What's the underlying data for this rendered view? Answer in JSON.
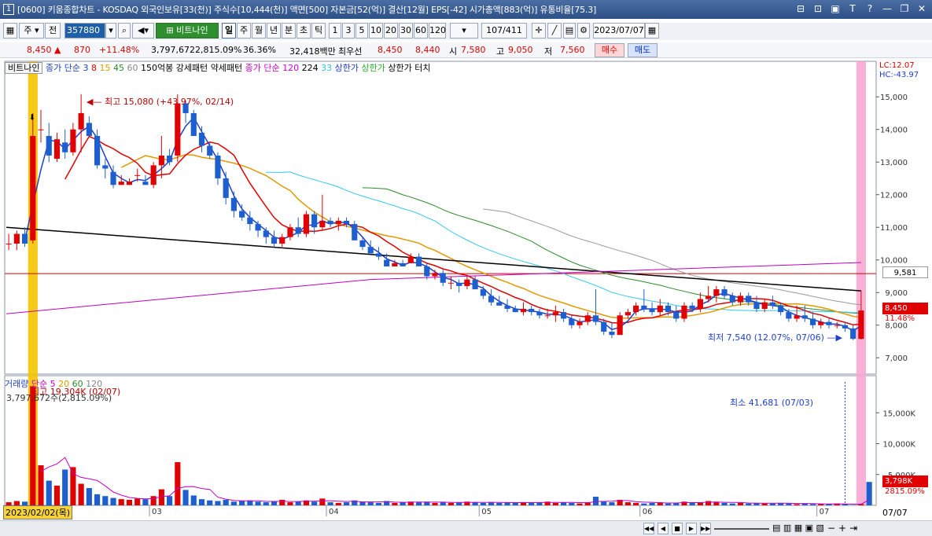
{
  "window": {
    "number": "1",
    "title": "[0600] 키움종합차트 - KOSDAQ 외국인보유[33(천)] 주식수[10,444(천)] 액면[500] 자본금[52(억)] 결산[12월] EPS[-42] 시가총액[883(억)] 유통비율[75.3]"
  },
  "toolbar": {
    "market": "주",
    "type": "전",
    "code": "357880",
    "stock_name": "비트나인",
    "periods": [
      "일",
      "주",
      "월",
      "년",
      "분",
      "초",
      "틱"
    ],
    "active_period": "일",
    "intervals": [
      "1",
      "3",
      "5",
      "10",
      "20",
      "30",
      "60",
      "120"
    ],
    "count": "107",
    "count_total": "/411",
    "date": "2023/07/07"
  },
  "quote": {
    "price": "8,450",
    "arrow": "▲",
    "change": "870",
    "change_pct": "+11.48%",
    "volume": "3,797,672",
    "turnover": "2,815.09%",
    "turnover2": "36.36%",
    "amount": "32,418백만",
    "bid_label": "최우선",
    "ask": "8,450",
    "bid": "8,440",
    "open_label": "시",
    "open": "7,580",
    "high_label": "고",
    "high": "9,050",
    "low_label": "저",
    "low": "7,560",
    "buy_label": "매수",
    "sell_label": "매도"
  },
  "legend_top": {
    "name": "비트나인",
    "ma_label": "종가 단순",
    "ma_periods": [
      "3",
      "8",
      "15",
      "45",
      "60"
    ],
    "box1": "150억봉 강세패턴",
    "box2": "약세패턴",
    "ma2_label": "종가 단순 120",
    "ma2_a": "224",
    "ma2_b": "33",
    "limit1": "상한가",
    "limit2": "상한가",
    "limit3": "상한가 터치"
  },
  "legend_vol": {
    "label": "거래량",
    "ma_label": "단순 5",
    "p20": "20",
    "p60": "60",
    "p120": "120",
    "max_text": "최고 19,304K (02/07)",
    "cur_text": "3,797,672주(2,815.09%)"
  },
  "annotations": {
    "high": "최고 15,080 (+43.97%, 02/14)",
    "low": "최저 7,540 (12.07%, 07/06)",
    "vol_min": "최소 41,681 (07/03)",
    "lc": "LC:12.07",
    "hc": "HC:-43.97",
    "hline_value": "9,581",
    "price_tag": "8,450",
    "pct_tag": "11.48%",
    "vol_tag": "3,798K",
    "vol_pct_tag": "2815.09%"
  },
  "x_axis": {
    "start_date": "2023/02/02(목)",
    "months": [
      "03",
      "04",
      "05",
      "06",
      "07"
    ],
    "end": "07/07"
  },
  "chart_data": [
    {
      "type": "candlestick",
      "y_ticks": [
        "15,000",
        "14,000",
        "13,000",
        "12,000",
        "11,000",
        "10,000",
        "9,000",
        "8,000",
        "7,000"
      ],
      "ylim": [
        6500,
        15800
      ],
      "ohlc": [
        [
          10500,
          10800,
          10300,
          10500
        ],
        [
          10500,
          10900,
          10300,
          10800
        ],
        [
          10800,
          11000,
          10400,
          10500
        ],
        [
          10600,
          14500,
          10500,
          13800
        ],
        [
          14000,
          14600,
          13600,
          14000
        ],
        [
          13800,
          14200,
          13000,
          13200
        ],
        [
          13100,
          13900,
          13000,
          13700
        ],
        [
          13600,
          14000,
          13100,
          13300
        ],
        [
          13300,
          14200,
          13200,
          14000
        ],
        [
          14000,
          15080,
          13300,
          14500
        ],
        [
          14200,
          14400,
          13800,
          13800
        ],
        [
          13800,
          14000,
          12800,
          12900
        ],
        [
          12900,
          13100,
          12500,
          12800
        ],
        [
          12700,
          12900,
          12200,
          12300
        ],
        [
          12300,
          12600,
          12300,
          12400
        ],
        [
          12300,
          12500,
          12300,
          12400
        ],
        [
          12600,
          12800,
          12400,
          12600
        ],
        [
          12400,
          12600,
          12300,
          12300
        ],
        [
          12300,
          13000,
          12200,
          12900
        ],
        [
          12900,
          13800,
          12500,
          13200
        ],
        [
          13200,
          13400,
          12900,
          13000
        ],
        [
          13200,
          15080,
          13000,
          14800
        ],
        [
          14800,
          14900,
          14200,
          14500
        ],
        [
          14500,
          14600,
          13800,
          13800
        ],
        [
          13900,
          14100,
          13300,
          13500
        ],
        [
          13500,
          13600,
          13100,
          13200
        ],
        [
          13200,
          13300,
          12300,
          12500
        ],
        [
          12500,
          12700,
          11700,
          11900
        ],
        [
          11900,
          12100,
          11300,
          11500
        ],
        [
          11500,
          11700,
          11200,
          11300
        ],
        [
          11300,
          11500,
          10900,
          11100
        ],
        [
          11100,
          11200,
          10700,
          10900
        ],
        [
          10900,
          11000,
          10500,
          10700
        ],
        [
          10700,
          10900,
          10400,
          10500
        ],
        [
          10500,
          10800,
          10400,
          10700
        ],
        [
          10700,
          11100,
          10600,
          11000
        ],
        [
          11000,
          11300,
          10700,
          10800
        ],
        [
          10800,
          11500,
          10700,
          11400
        ],
        [
          11400,
          11500,
          10800,
          11000
        ],
        [
          11000,
          12000,
          10900,
          11200
        ],
        [
          11200,
          11300,
          11000,
          11100
        ],
        [
          11100,
          11300,
          10900,
          11200
        ],
        [
          11200,
          11300,
          11000,
          11100
        ],
        [
          11100,
          11200,
          10600,
          10600
        ],
        [
          10600,
          10700,
          10300,
          10400
        ],
        [
          10400,
          10600,
          10200,
          10200
        ],
        [
          10200,
          10400,
          10000,
          10100
        ],
        [
          10000,
          10200,
          9800,
          9800
        ],
        [
          9800,
          10000,
          9800,
          9900
        ],
        [
          9900,
          10000,
          9800,
          9800
        ],
        [
          9900,
          10200,
          9900,
          10100
        ],
        [
          10100,
          10200,
          9800,
          9800
        ],
        [
          9800,
          9900,
          9400,
          9500
        ],
        [
          9500,
          9700,
          9400,
          9600
        ],
        [
          9600,
          9700,
          9200,
          9300
        ],
        [
          9300,
          9500,
          9100,
          9300
        ],
        [
          9300,
          9400,
          9000,
          9200
        ],
        [
          9200,
          9500,
          9100,
          9400
        ],
        [
          9400,
          9500,
          9100,
          9100
        ],
        [
          9100,
          9200,
          8800,
          8900
        ],
        [
          8900,
          9100,
          8600,
          8700
        ],
        [
          8700,
          8900,
          8600,
          8600
        ],
        [
          8600,
          8800,
          8400,
          8500
        ],
        [
          8500,
          8600,
          8400,
          8400
        ],
        [
          8400,
          8700,
          8300,
          8500
        ],
        [
          8500,
          8600,
          8300,
          8400
        ],
        [
          8400,
          8500,
          8200,
          8300
        ],
        [
          8300,
          8500,
          8200,
          8300
        ],
        [
          8300,
          8600,
          8100,
          8400
        ],
        [
          8400,
          8500,
          8100,
          8200
        ],
        [
          8200,
          8300,
          7900,
          8000
        ],
        [
          8000,
          8200,
          7900,
          8100
        ],
        [
          8100,
          8400,
          8000,
          8300
        ],
        [
          8300,
          9100,
          8000,
          8100
        ],
        [
          8100,
          8200,
          7700,
          7800
        ],
        [
          7800,
          8100,
          7600,
          7700
        ],
        [
          7700,
          8400,
          7700,
          8300
        ],
        [
          8300,
          8500,
          8200,
          8400
        ],
        [
          8400,
          8700,
          8300,
          8600
        ],
        [
          8600,
          9100,
          8400,
          8500
        ],
        [
          8500,
          8700,
          8300,
          8400
        ],
        [
          8400,
          8800,
          8300,
          8600
        ],
        [
          8600,
          8700,
          8300,
          8400
        ],
        [
          8400,
          8600,
          8100,
          8200
        ],
        [
          8200,
          8700,
          8100,
          8600
        ],
        [
          8600,
          8700,
          8400,
          8500
        ],
        [
          8500,
          9000,
          8400,
          8800
        ],
        [
          8800,
          9200,
          8700,
          8900
        ],
        [
          8900,
          9200,
          8700,
          9100
        ],
        [
          9100,
          9200,
          8800,
          8900
        ],
        [
          8900,
          9000,
          8600,
          8700
        ],
        [
          8700,
          9000,
          8600,
          8900
        ],
        [
          8900,
          9000,
          8600,
          8700
        ],
        [
          8700,
          8900,
          8400,
          8500
        ],
        [
          8500,
          8800,
          8400,
          8700
        ],
        [
          8700,
          8900,
          8500,
          8600
        ],
        [
          8600,
          8700,
          8300,
          8400
        ],
        [
          8400,
          8500,
          8100,
          8200
        ],
        [
          8200,
          8600,
          8100,
          8300
        ],
        [
          8300,
          8600,
          8100,
          8200
        ],
        [
          8200,
          8400,
          7900,
          8000
        ],
        [
          8000,
          8200,
          7900,
          8100
        ],
        [
          8100,
          8200,
          7900,
          8000
        ],
        [
          8000,
          8100,
          7900,
          8000
        ],
        [
          8000,
          8100,
          7800,
          7900
        ],
        [
          7900,
          8000,
          7540,
          7580
        ],
        [
          7580,
          9050,
          7560,
          8450
        ]
      ]
    },
    {
      "type": "bar",
      "title": "거래량",
      "y_ticks": [
        "15,000K",
        "10,000K",
        "5,000K"
      ],
      "ylim": [
        0,
        20000
      ],
      "values": [
        500,
        700,
        600,
        19304,
        6500,
        4000,
        3200,
        5800,
        6200,
        3500,
        2800,
        1800,
        1500,
        1200,
        1000,
        900,
        1100,
        1000,
        1500,
        2600,
        1500,
        7000,
        2500,
        1600,
        1000,
        800,
        700,
        900,
        600,
        700,
        800,
        600,
        500,
        600,
        900,
        500,
        600,
        800,
        600,
        1100,
        500,
        400,
        500,
        800,
        600,
        500,
        400,
        700,
        400,
        500,
        600,
        500,
        600,
        400,
        500,
        400,
        500,
        600,
        500,
        400,
        500,
        400,
        500,
        400,
        500,
        400,
        500,
        600,
        400,
        500,
        400,
        300,
        500,
        1400,
        600,
        500,
        900,
        500,
        400,
        300,
        400,
        500,
        300,
        400,
        600,
        400,
        500,
        700,
        500,
        400,
        300,
        400,
        300,
        400,
        300,
        300,
        400,
        300,
        200,
        300,
        200,
        200,
        200,
        300,
        200,
        41.7,
        200,
        3798
      ],
      "colors_up": "#e00000",
      "colors_down": "#1e5fd0"
    }
  ]
}
